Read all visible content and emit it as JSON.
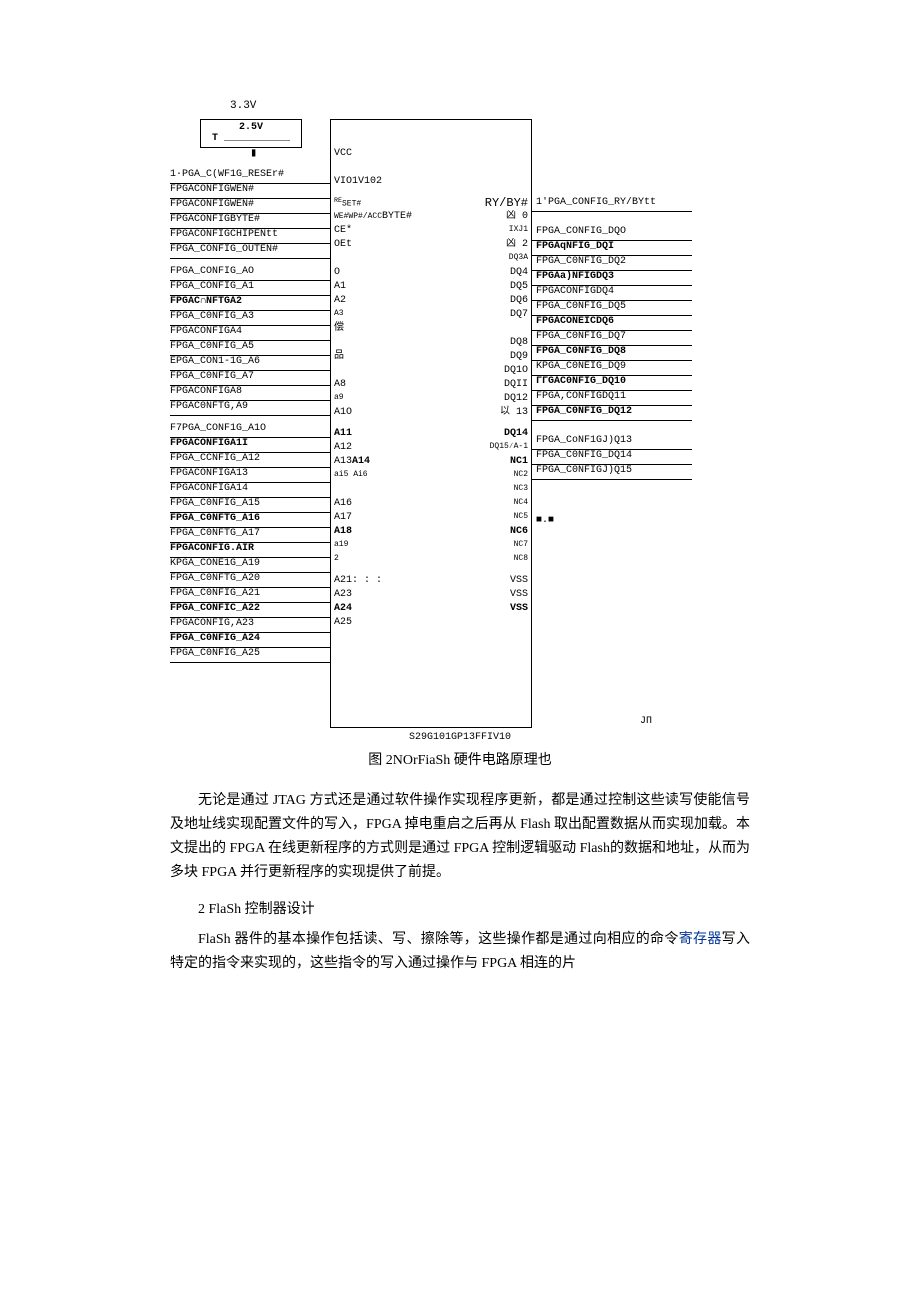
{
  "voltages": {
    "vtop": "3.3V",
    "vmid": "2.5V",
    "t": "T"
  },
  "left": [
    "1·PGA_C(WF1G_RESEr#",
    "FPGACONFIGWEN#",
    "FPGACONFIGWEN#",
    "FPGACONFIGBYTE#",
    "FPGACONFIGCHIPENtt",
    "FPGA_CONFIG_OUTEN#",
    "FPGA_CONFIG_AO",
    "FPGA_CONFIG_A1",
    "FPGAC∩NFTGA2",
    "FPGA_C0NFIG_A3",
    "FPGACONFIGA4",
    "FPGA_C0NFIG_A5",
    "EPGA_CON1-1G_A6",
    "FPGA_C0NFIG_A7",
    "FPGACONFIGA8",
    "FPGAC0NFTG,A9",
    "F7PGA_CONF1G_A1O",
    "FPGACONFIGA1I",
    "FPGA_CCNFIG_A12",
    "FPGACONFIGA13",
    "FPGACONFIGA14",
    "FPGA_C0NFIG_A15",
    "FPGA_C0NFTG_A16",
    "FPGA_C0NFTG_A17",
    "FPGACONFIG.AIR",
    "KPGA_CONE1G_A19",
    "FPGA_C0NFTG_A20",
    "FPGA_C0NFIG_A21",
    "FPGA_CONFIC_A22",
    "FPGACONFIG,A23",
    "FPGA_C0NFIG_A24",
    "FPGA_C0NFIG_A25"
  ],
  "left_bold": [
    false,
    false,
    false,
    false,
    false,
    false,
    false,
    false,
    true,
    false,
    false,
    false,
    false,
    false,
    false,
    false,
    false,
    true,
    false,
    false,
    false,
    false,
    true,
    false,
    true,
    false,
    false,
    false,
    true,
    false,
    true,
    false
  ],
  "chip_top": [
    "VCC",
    "",
    "VIO1V102"
  ],
  "pins": [
    {
      "l": "RESET#",
      "r": "RY/BY#"
    },
    {
      "l": "WE#WP#/ACCBYTE#",
      "r": "凶 0"
    },
    {
      "l": "CE*",
      "r": "IXJ1"
    },
    {
      "l": "OEt",
      "r": "凶 2"
    },
    {
      "l": "",
      "r": "DQ3A"
    },
    {
      "l": "O",
      "r": "DQ4"
    },
    {
      "l": "A1",
      "r": "DQ5"
    },
    {
      "l": "A2",
      "r": "DQ6"
    },
    {
      "l": "A3",
      "r": "DQ7"
    },
    {
      "l": "偿",
      "r": ""
    },
    {
      "l": "",
      "r": "DQ8"
    },
    {
      "l": "品",
      "r": "DQ9"
    },
    {
      "l": "",
      "r": "DQ1O"
    },
    {
      "l": "A8",
      "r": "DQII"
    },
    {
      "l": "a9",
      "r": "DQ12"
    },
    {
      "l": "A1O",
      "r": "以 13"
    },
    {
      "l": "A11",
      "r": "DQ14"
    },
    {
      "l": "A12",
      "r": "DQ15∕A-1"
    },
    {
      "l": "A13A14",
      "r": "NC1"
    },
    {
      "l": "ai5 Ai6",
      "r": "NC2"
    },
    {
      "l": "",
      "r": "NC3"
    },
    {
      "l": "A16",
      "r": "NC4"
    },
    {
      "l": "A17",
      "r": "NC5"
    },
    {
      "l": "A18",
      "r": "NC6"
    },
    {
      "l": "a19",
      "r": "NC7"
    },
    {
      "l": "2",
      "r": "NC8"
    },
    {
      "l": "A21: : :",
      "r": "VSS"
    },
    {
      "l": "A23",
      "r": "VSS"
    },
    {
      "l": "A24",
      "r": "VSS"
    },
    {
      "l": "A25",
      "r": ""
    }
  ],
  "pins_bold_l": [
    false,
    false,
    false,
    false,
    false,
    false,
    false,
    false,
    false,
    false,
    false,
    false,
    false,
    false,
    false,
    false,
    true,
    false,
    false,
    false,
    false,
    false,
    false,
    true,
    false,
    false,
    false,
    false,
    true,
    false
  ],
  "pins_bold_r": [
    false,
    false,
    false,
    false,
    false,
    false,
    false,
    false,
    false,
    false,
    false,
    false,
    false,
    false,
    false,
    false,
    true,
    false,
    true,
    false,
    false,
    false,
    false,
    true,
    false,
    false,
    false,
    false,
    true,
    false
  ],
  "right": [
    "1'PGA_CONFIG_RY/BYtt",
    "",
    "FPGA_CONFIG_DQO",
    "FPGAqNFIG_DQI",
    "FPGA_C0NFIG_DQ2",
    "FPGAa)NFIGDQ3",
    "FPGACONFIGDQ4",
    "FPGA_C0NFIG_DQ5",
    "FPGACONEICDQ6",
    "FPGA_C0NFIG_DQ7",
    "FPGA_C0NFIG_DQ8",
    "KPGA_C0NEIG_DQ9",
    "ΓΓGAC0NFIG_DQ10",
    "FPGA,CONFIGDQ11",
    "FPGA_C0NFIG_DQ12",
    "",
    "FPGA_CoNF1GJ)Q13",
    "FPGA_C0NFIG_DQ14",
    "FPGA_C0NFIGJ)Q15"
  ],
  "right_bold": [
    false,
    false,
    false,
    true,
    false,
    true,
    false,
    false,
    true,
    false,
    true,
    false,
    true,
    false,
    true,
    false,
    false,
    false,
    false
  ],
  "trailing_marker": "JΠ",
  "decor_marker": "■.■",
  "part": "S29G101GP13FFIV10",
  "caption": "图 2NOrFiaSh 硬件电路原理也",
  "para1a": "无论是通过 JTAG 方式还是通过软件操作实现程序更新，都是通过控制这些读写使能信号及地址线实现配置文件的写入，FPGA 掉电重启之后再从 Flash 取出配置数据从而实现加载。本文提出的 FPGA 在线更新程序的方式则是通过 FPGA 控制逻辑驱动 Flash的数据和地址，从而为多块 FPGA 并行更新程序的实现提供了前提。",
  "sect2": "2 FlaSh 控制器设计",
  "para2a": "FlaSh 器件的基本操作包括读、写、擦除等，这些操作都是通过向相应的命令",
  "para2b": "写入特定的指令来实现的，这些指令的写入通过操作与 FPGA 相连的片",
  "linktext": "寄存器"
}
